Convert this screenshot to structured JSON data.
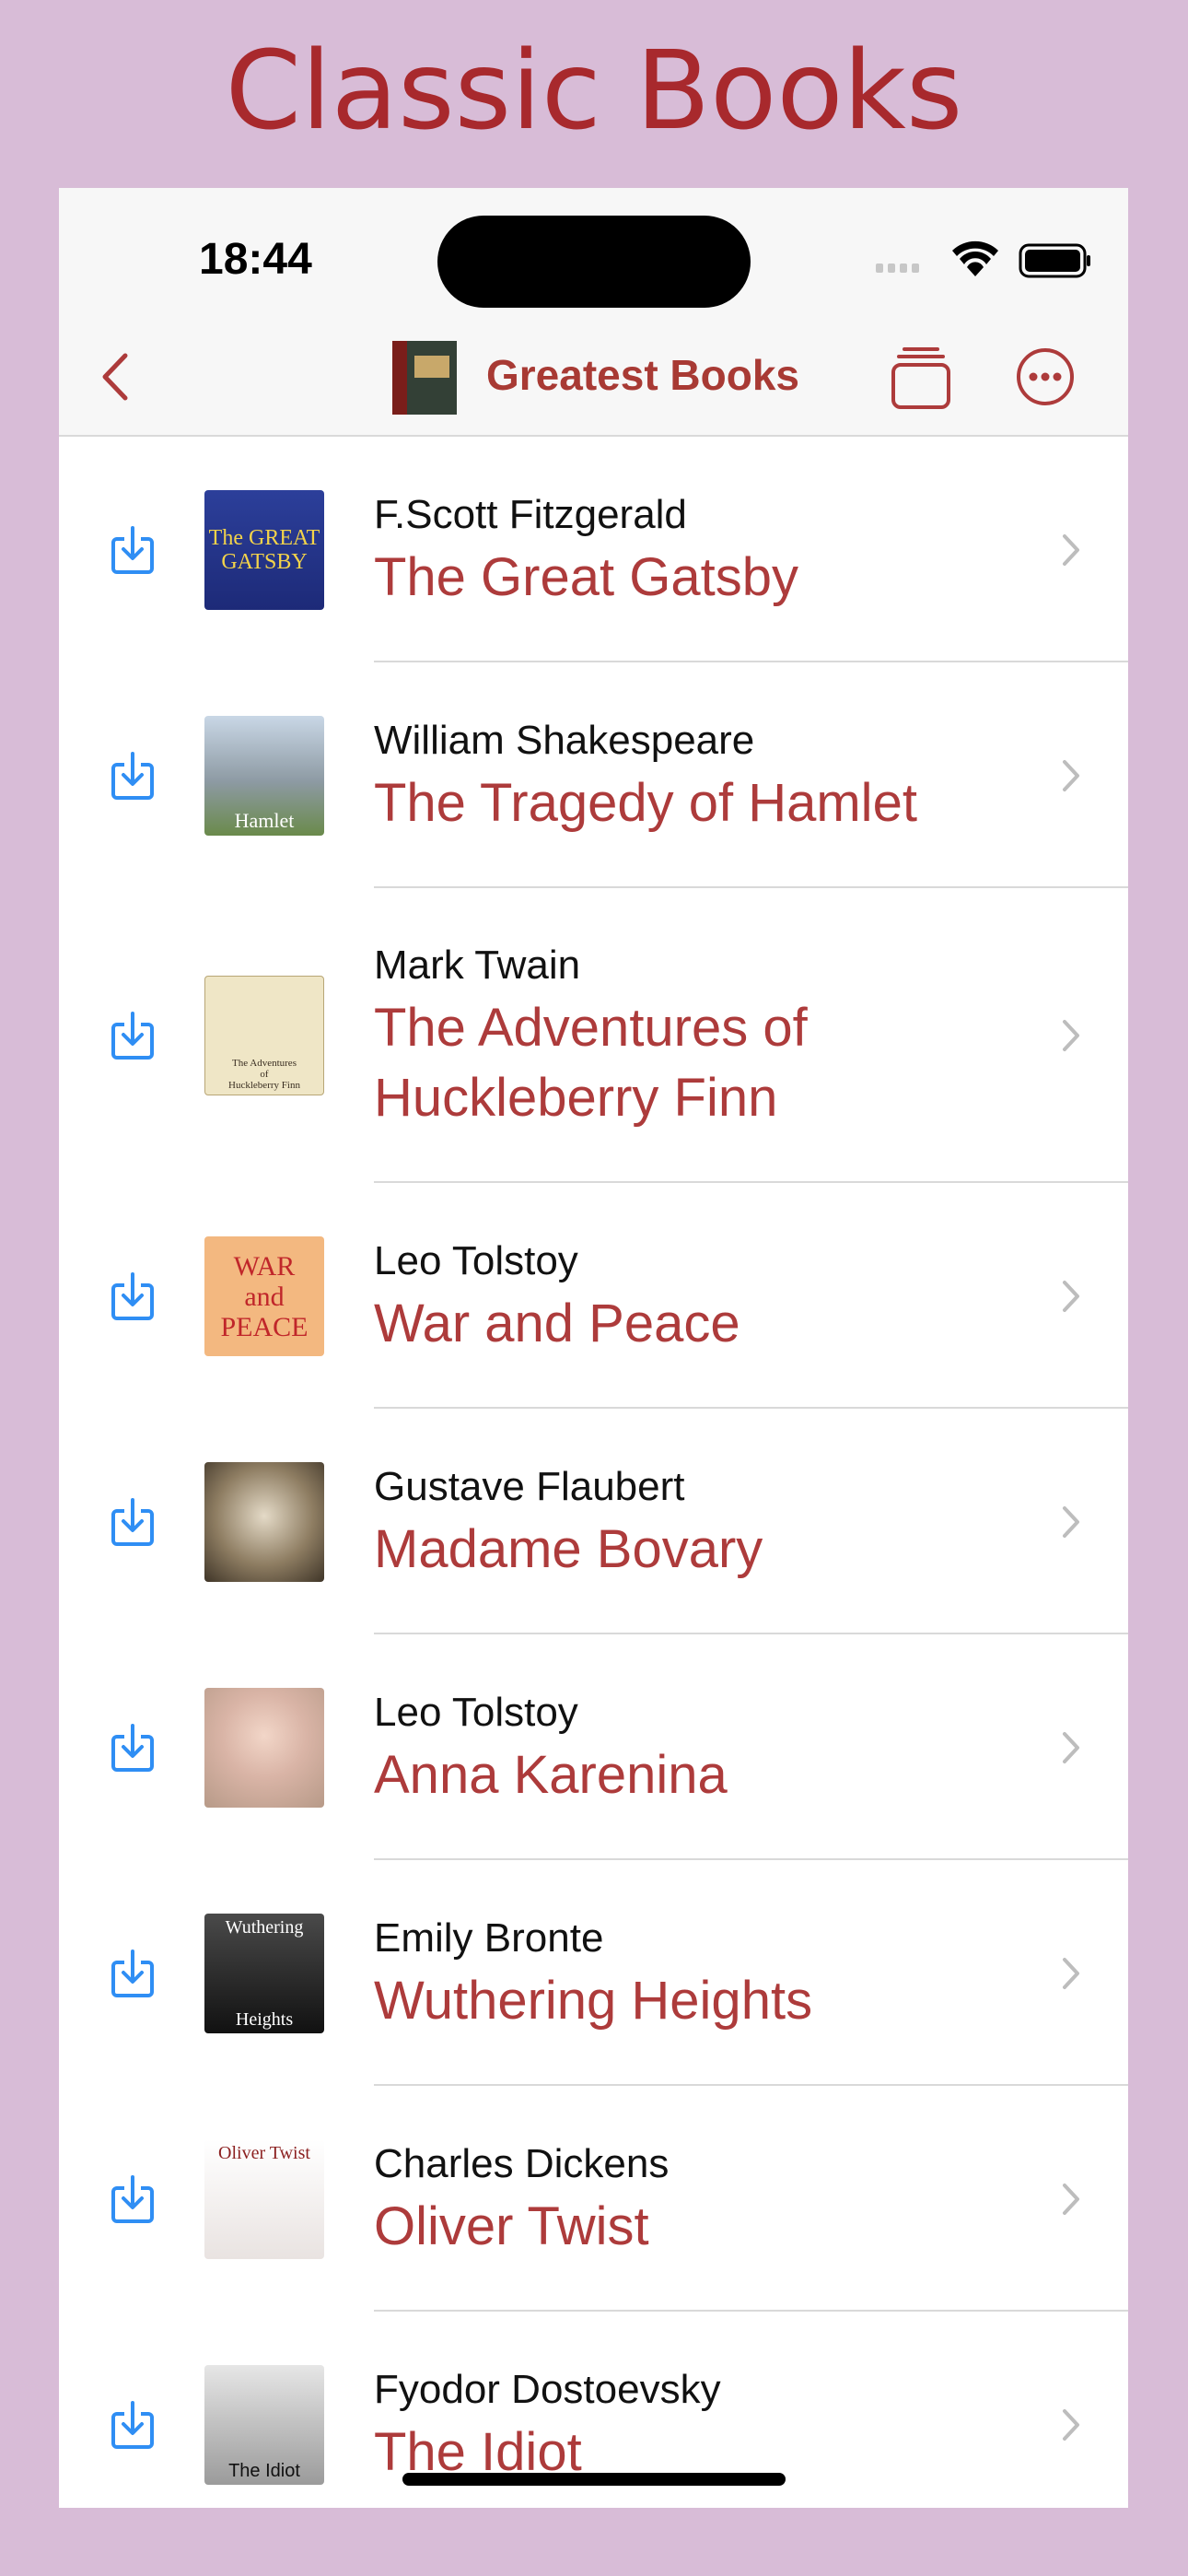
{
  "page": {
    "headline": "Classic Books"
  },
  "status_bar": {
    "time": "18:44"
  },
  "nav": {
    "title": "Greatest Books"
  },
  "books": [
    {
      "author": "F.Scott Fitzgerald",
      "title": "The Great Gatsby",
      "cover_text": [
        "The GREAT",
        "GATSBY"
      ]
    },
    {
      "author": "William Shakespeare",
      "title": "The Tragedy of Hamlet",
      "cover_text": [
        "Hamlet"
      ]
    },
    {
      "author": "Mark Twain",
      "title": "The Adventures of Huckleberry Finn",
      "cover_text": [
        "The Adventures",
        "of",
        "Huckleberry Finn"
      ]
    },
    {
      "author": "Leo Tolstoy",
      "title": "War and Peace",
      "cover_text": [
        "WAR",
        "and",
        "PEACE"
      ]
    },
    {
      "author": "Gustave Flaubert",
      "title": "Madame Bovary",
      "cover_text": []
    },
    {
      "author": "Leo Tolstoy",
      "title": "Anna Karenina",
      "cover_text": []
    },
    {
      "author": "Emily Bronte",
      "title": "Wuthering Heights",
      "cover_text": [
        "Wuthering",
        "Heights"
      ]
    },
    {
      "author": "Charles Dickens",
      "title": "Oliver Twist",
      "cover_text": [
        "Oliver Twist"
      ]
    },
    {
      "author": "Fyodor Dostoevsky",
      "title": "The Idiot",
      "cover_text": [
        "The Idiot"
      ]
    }
  ],
  "colors": {
    "accent": "#ad3b3b",
    "icon_blue": "#2f8ef4",
    "background": "#d8bcd7"
  }
}
